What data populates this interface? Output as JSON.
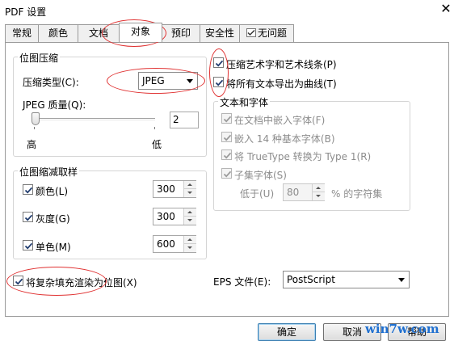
{
  "window": {
    "title": "PDF 设置",
    "close_symbol": "✕"
  },
  "tabs": [
    {
      "label": "常规"
    },
    {
      "label": "颜色"
    },
    {
      "label": "文档"
    },
    {
      "label": "对象",
      "active": true
    },
    {
      "label": "预印"
    },
    {
      "label": "安全性"
    },
    {
      "label": "无问题",
      "icon": "check-doc-icon"
    }
  ],
  "bitmap_compression": {
    "title": "位图压缩",
    "type_label": "压缩类型(C):",
    "type_value": "JPEG",
    "quality_label": "JPEG 质量(Q):",
    "quality_value": "2",
    "slider_high": "高",
    "slider_low": "低"
  },
  "downsample": {
    "title": "位图缩减取样",
    "rows": [
      {
        "label": "颜色(L)",
        "checked": true,
        "value": "300"
      },
      {
        "label": "灰度(G)",
        "checked": true,
        "value": "300"
      },
      {
        "label": "单色(M)",
        "checked": true,
        "value": "600"
      }
    ]
  },
  "right_options": {
    "compress_art": {
      "label": "压缩艺术字和艺术线条(P)",
      "checked": true
    },
    "text_as_curves": {
      "label": "将所有文本导出为曲线(T)",
      "checked": true
    }
  },
  "text_font": {
    "title": "文本和字体",
    "embed_in_doc": {
      "label": "在文档中嵌入字体(F)",
      "checked": true
    },
    "embed_14": {
      "label": "嵌入 14 种基本字体(B)",
      "checked": true
    },
    "truetype_to_type1": {
      "label": "将 TrueType 转换为 Type 1(R)",
      "checked": true
    },
    "subset": {
      "label": "子集字体(S)",
      "checked": true
    },
    "below_label": "低于(U)",
    "below_value": "80",
    "below_suffix": "% 的字符集"
  },
  "render_complex_fill": {
    "label": "将复杂填充渲染为位图(X)",
    "checked": true
  },
  "eps": {
    "label": "EPS 文件(E):",
    "value": "PostScript"
  },
  "buttons": {
    "ok": "确定",
    "cancel": "取消",
    "help": "帮助"
  },
  "watermark": "win7w.com",
  "colors": {
    "annotation": "#e03131",
    "watermark": "#1e6fd0"
  }
}
